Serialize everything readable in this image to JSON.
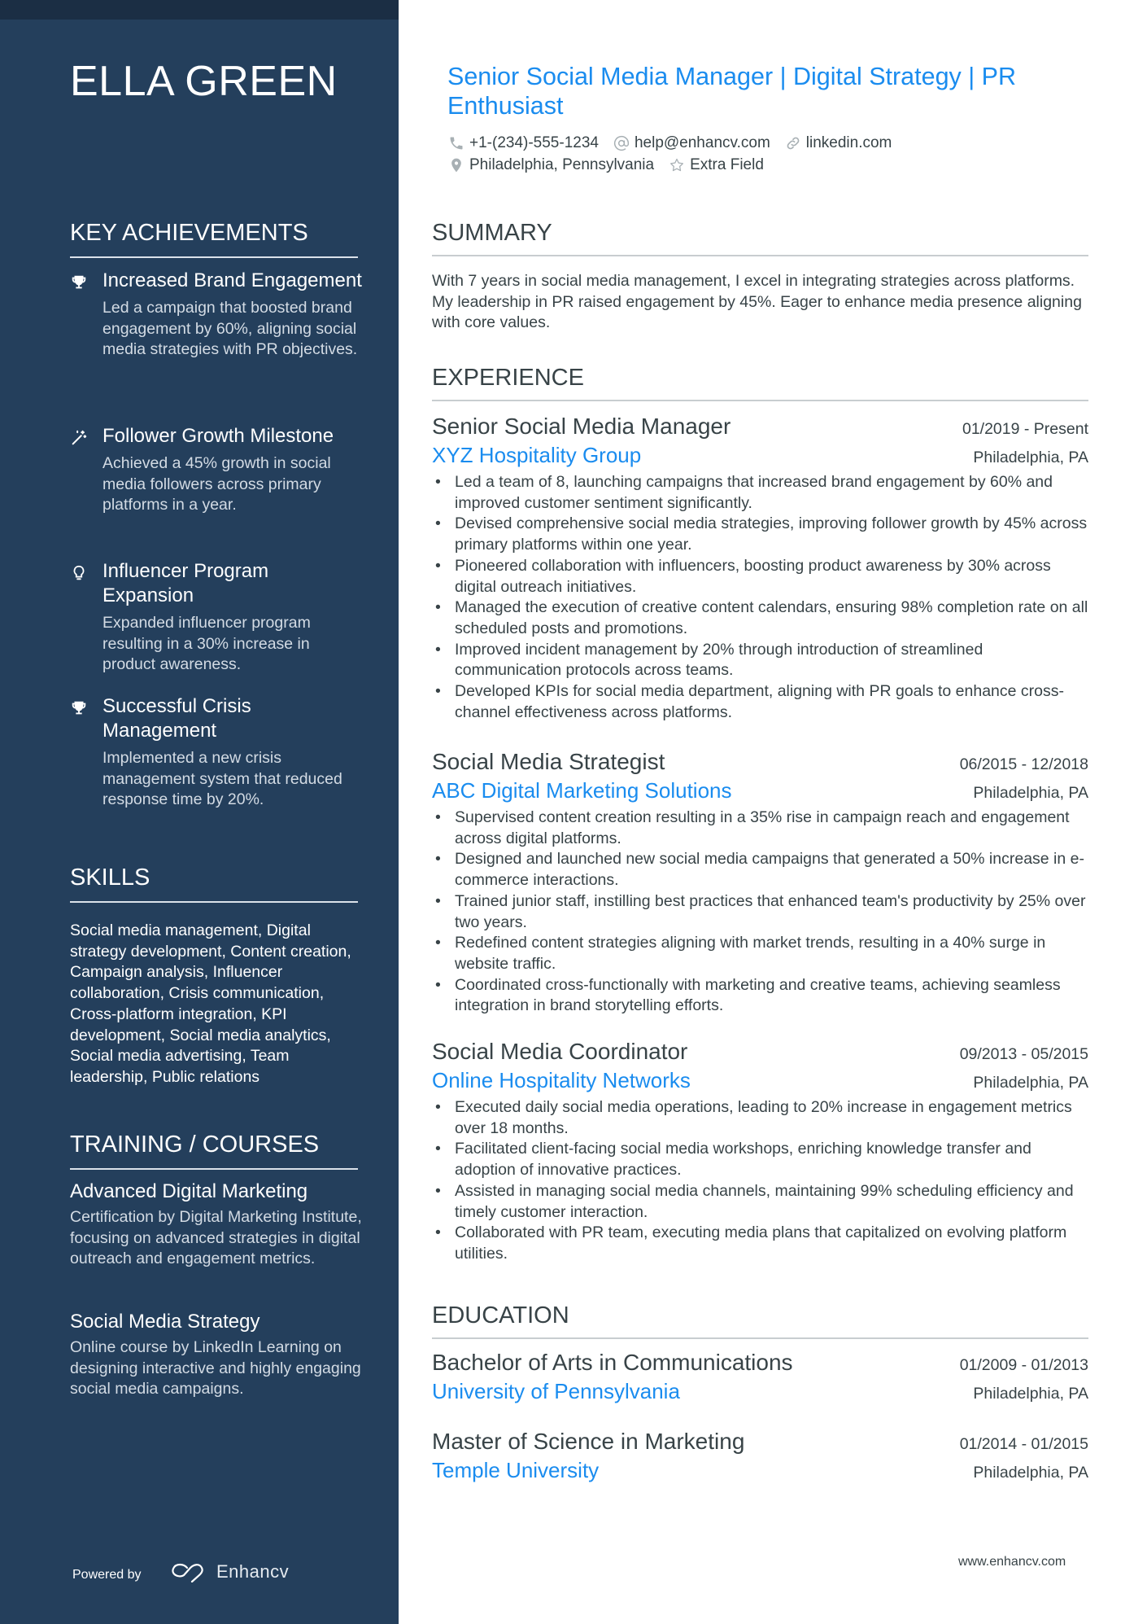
{
  "sidebar": {
    "name": "ELLA GREEN",
    "achievements_heading": "KEY ACHIEVEMENTS",
    "achievements": [
      {
        "icon": "trophy-icon",
        "title": "Increased Brand Engagement",
        "desc": "Led a campaign that boosted brand engagement by 60%, aligning social media strategies with PR objectives."
      },
      {
        "icon": "magic-wand-icon",
        "title": "Follower Growth Milestone",
        "desc": "Achieved a 45% growth in social media followers across primary platforms in a year."
      },
      {
        "icon": "lightbulb-icon",
        "title": "Influencer Program Expansion",
        "desc": "Expanded influencer program resulting in a 30% increase in product awareness."
      },
      {
        "icon": "trophy-icon",
        "title": "Successful Crisis Management",
        "desc": "Implemented a new crisis management system that reduced response time by 20%."
      }
    ],
    "skills_heading": "SKILLS",
    "skills_text": "Social media management, Digital strategy development, Content creation, Campaign analysis, Influencer collaboration, Crisis communication, Cross-platform integration, KPI development, Social media analytics, Social media advertising, Team leadership, Public relations",
    "training_heading": "TRAINING / COURSES",
    "courses": [
      {
        "title": "Advanced Digital Marketing",
        "desc": "Certification by Digital Marketing Institute, focusing on advanced strategies in digital outreach and engagement metrics."
      },
      {
        "title": "Social Media Strategy",
        "desc": "Online course by LinkedIn Learning on designing interactive and highly engaging social media campaigns."
      }
    ],
    "powered_by": "Powered by",
    "brand_name": "Enhancv"
  },
  "header": {
    "title": "Senior Social Media Manager | Digital Strategy | PR Enthusiast",
    "contacts": {
      "phone": "+1-(234)-555-1234",
      "email": "help@enhancv.com",
      "link": "linkedin.com",
      "location": "Philadelphia, Pennsylvania",
      "extra": "Extra Field"
    }
  },
  "summary": {
    "heading": "SUMMARY",
    "text": "With 7 years in social media management, I excel in integrating strategies across platforms. My leadership in PR raised engagement by 45%. Eager to enhance media presence aligning with core values."
  },
  "experience": {
    "heading": "EXPERIENCE",
    "jobs": [
      {
        "role": "Senior Social Media Manager",
        "date": "01/2019 - Present",
        "company": "XYZ Hospitality Group",
        "location": "Philadelphia, PA",
        "bullets": [
          "Led a team of 8, launching campaigns that increased brand engagement by 60% and improved customer sentiment significantly.",
          "Devised comprehensive social media strategies, improving follower growth by 45% across primary platforms within one year.",
          "Pioneered collaboration with influencers, boosting product awareness by 30% across digital outreach initiatives.",
          "Managed the execution of creative content calendars, ensuring 98% completion rate on all scheduled posts and promotions.",
          "Improved incident management by 20% through introduction of streamlined communication protocols across teams.",
          "Developed KPIs for social media department, aligning with PR goals to enhance cross-channel effectiveness across platforms."
        ]
      },
      {
        "role": "Social Media Strategist",
        "date": "06/2015 - 12/2018",
        "company": "ABC Digital Marketing Solutions",
        "location": "Philadelphia, PA",
        "bullets": [
          "Supervised content creation resulting in a 35% rise in campaign reach and engagement across digital platforms.",
          "Designed and launched new social media campaigns that generated a 50% increase in e-commerce interactions.",
          "Trained junior staff, instilling best practices that enhanced team's productivity by 25% over two years.",
          "Redefined content strategies aligning with market trends, resulting in a 40% surge in website traffic.",
          "Coordinated cross-functionally with marketing and creative teams, achieving seamless integration in brand storytelling efforts."
        ]
      },
      {
        "role": "Social Media Coordinator",
        "date": "09/2013 - 05/2015",
        "company": "Online Hospitality Networks",
        "location": "Philadelphia, PA",
        "bullets": [
          "Executed daily social media operations, leading to 20% increase in engagement metrics over 18 months.",
          "Facilitated client-facing social media workshops, enriching knowledge transfer and adoption of innovative practices.",
          "Assisted in managing social media channels, maintaining 99% scheduling efficiency and timely customer interaction.",
          "Collaborated with PR team, executing media plans that capitalized on evolving platform utilities."
        ]
      }
    ]
  },
  "education": {
    "heading": "EDUCATION",
    "items": [
      {
        "degree": "Bachelor of Arts in Communications",
        "date": "01/2009 - 01/2013",
        "school": "University of Pennsylvania",
        "location": "Philadelphia, PA"
      },
      {
        "degree": "Master of Science in Marketing",
        "date": "01/2014 - 01/2015",
        "school": "Temple University",
        "location": "Philadelphia, PA"
      }
    ]
  },
  "footer": {
    "url": "www.enhancv.com"
  },
  "colors": {
    "sidebar_bg": "#243f5c",
    "sidebar_top": "#1b2e44",
    "accent": "#1a8cef",
    "text": "#384347"
  }
}
